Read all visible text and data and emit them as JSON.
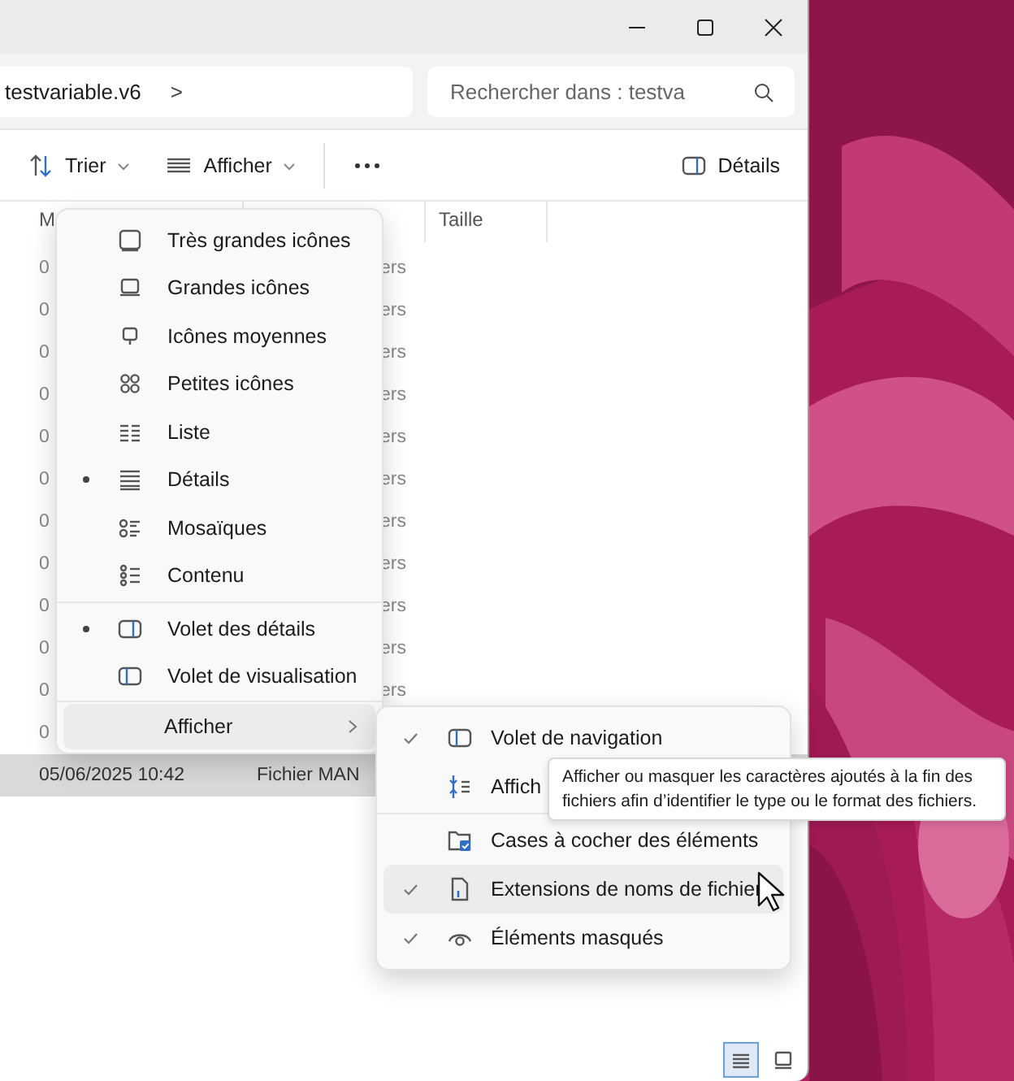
{
  "address_bar": {
    "path": "testvariable.v6",
    "separator": ">"
  },
  "search": {
    "placeholder": "Rechercher dans : testva"
  },
  "toolbar": {
    "items": [
      {
        "kind": "sort",
        "label": "Trier"
      },
      {
        "kind": "view",
        "label": "Afficher"
      },
      {
        "kind": "more"
      },
      {
        "kind": "pane",
        "label": "Détails"
      }
    ]
  },
  "file_list": {
    "column_1": "M",
    "column_3": "Taille",
    "rows": [
      {
        "kind": "covered",
        "column_1": "0",
        "column_2": "ers",
        "selected": false
      },
      {
        "kind": "covered",
        "column_1": "0",
        "column_2": "ers",
        "selected": false
      },
      {
        "kind": "covered",
        "column_1": "0",
        "column_2": "ers",
        "selected": false
      },
      {
        "kind": "covered",
        "column_1": "0",
        "column_2": "ers",
        "selected": false
      },
      {
        "kind": "covered",
        "column_1": "0",
        "column_2": "ers",
        "selected": false
      },
      {
        "kind": "covered",
        "column_1": "0",
        "column_2": "ers",
        "selected": false
      },
      {
        "kind": "covered",
        "column_1": "0",
        "column_2": "ers",
        "selected": false
      },
      {
        "kind": "covered",
        "column_1": "0",
        "column_2": "ers",
        "selected": false
      },
      {
        "kind": "covered",
        "column_1": "0",
        "column_2": "ers",
        "selected": false
      },
      {
        "kind": "covered",
        "column_1": "0",
        "column_2": "ers",
        "selected": false
      },
      {
        "kind": "covered",
        "column_1": "0",
        "column_2": "ers",
        "selected": false
      },
      {
        "kind": "covered",
        "column_1": "0",
        "selected": false
      },
      {
        "kind": "full",
        "column_1": "05/06/2025 10:42",
        "column_2": "Fichier MAN",
        "selected": true
      }
    ]
  },
  "view_menu": {
    "sections": [
      [
        {
          "label": "Très grandes icônes",
          "selected": false
        },
        {
          "label": "Grandes icônes",
          "selected": false
        },
        {
          "label": "Icônes moyennes",
          "selected": false
        },
        {
          "label": "Petites icônes",
          "selected": false
        },
        {
          "label": "Liste",
          "selected": false
        },
        {
          "label": "Détails",
          "selected": true
        },
        {
          "label": "Mosaïques",
          "selected": false
        },
        {
          "label": "Contenu",
          "selected": false
        }
      ],
      [
        {
          "label": "Volet des détails",
          "selected": true
        },
        {
          "label": "Volet de visualisation",
          "selected": false
        }
      ],
      [
        {
          "label": "Afficher",
          "expanded": true
        }
      ]
    ]
  },
  "show_submenu": {
    "sections": [
      [
        {
          "label": "Volet de navigation",
          "checked": true,
          "hovered": false
        },
        {
          "label": "Affich",
          "checked": false,
          "hovered": false
        }
      ],
      [
        {
          "label": "Cases à cocher des éléments",
          "checked": false,
          "hovered": false
        },
        {
          "label": "Extensions de noms de fichier",
          "checked": true,
          "hovered": true
        },
        {
          "label": "Éléments masqués",
          "checked": true,
          "hovered": false
        }
      ]
    ]
  },
  "tooltip": {
    "text": "Afficher ou masquer les caractères ajoutés à la fin des fichiers afin d’identifier le type ou le format des fichiers."
  },
  "status_bar": {
    "views": [
      {
        "selected": true
      },
      {
        "selected": false
      }
    ]
  }
}
